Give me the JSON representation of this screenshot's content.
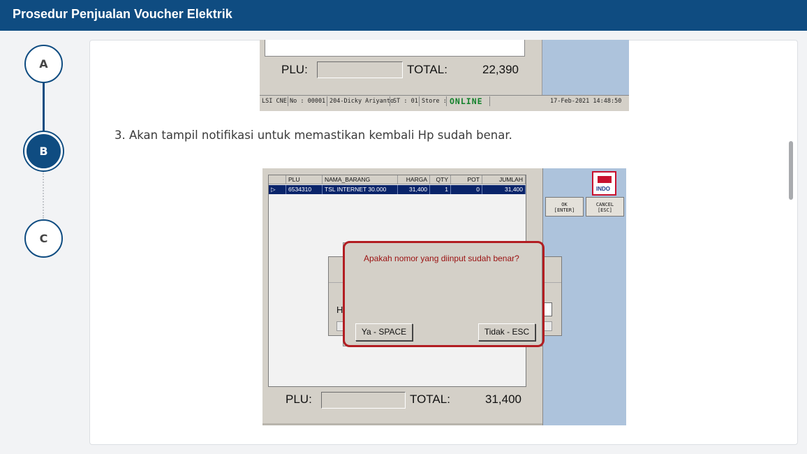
{
  "header": {
    "title": "Prosedur Penjualan Voucher Elektrik"
  },
  "steps": [
    {
      "label": "A"
    },
    {
      "label": "B"
    },
    {
      "label": "C"
    }
  ],
  "screenshot1": {
    "plu_label": "PLU:",
    "total_label": "TOTAL:",
    "total_value": "22,390",
    "status": {
      "terminal": "LSI CNE",
      "no": "No : 00001",
      "cashier": "204-Dicky Ariyanto",
      "st": "ST : 01",
      "store": "Store :",
      "connection": "ONLINE",
      "datetime": "17-Feb-2021 14:48:50"
    }
  },
  "instruction": "3. Akan tampil notifikasi untuk memastikan kembali Hp sudah benar.",
  "screenshot2": {
    "columns": [
      "PLU",
      "NAMA_BARANG",
      "HARGA",
      "QTY",
      "POT",
      "JUMLAH"
    ],
    "row": {
      "marker": "▷",
      "plu": "6534310",
      "nama_barang": "TSL INTERNET 30.000",
      "harga": "31,400",
      "qty": "1",
      "pot": "0",
      "jumlah": "31,400"
    },
    "side_buttons": {
      "ok_line1": "OK",
      "ok_line2": "[ENTER]",
      "cancel_line1": "CANCEL",
      "cancel_line2": "[ESC]"
    },
    "logo_text": "INDO",
    "background_label": "Ha",
    "dialog": {
      "question": "Apakah nomor yang diinput sudah benar?",
      "yes_button": "Ya - SPACE",
      "no_button": "Tidak - ESC"
    },
    "plu_label": "PLU:",
    "total_label": "TOTAL:",
    "total_value": "31,400"
  },
  "colors": {
    "header_bg": "#0f4c81",
    "highlight": "#b21d22",
    "pos_side_panel": "#adc3dc",
    "selected_row": "#0a246a"
  }
}
